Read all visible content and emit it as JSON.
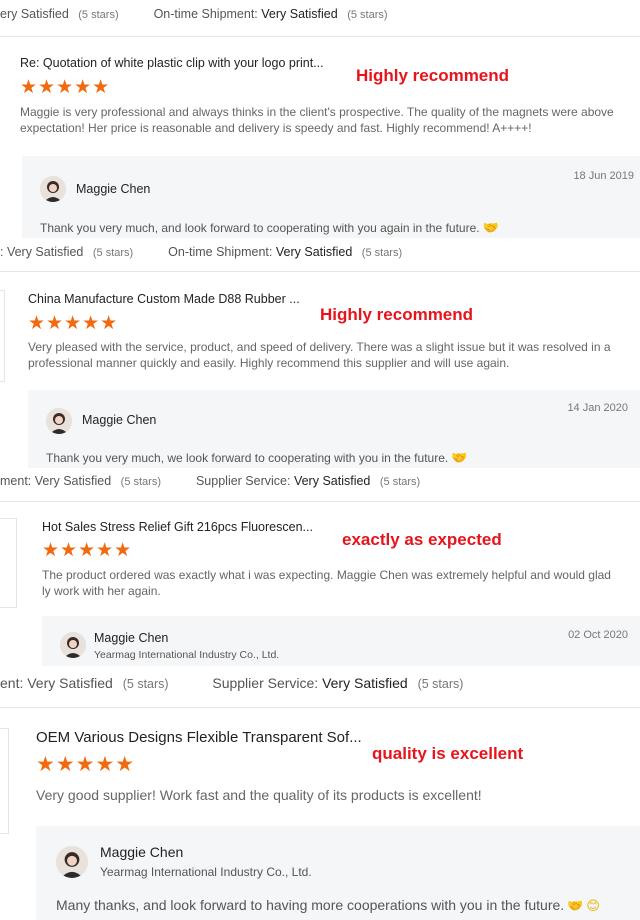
{
  "ratings": [
    {
      "k1": "ery Satisfied",
      "s1": "(5 stars)",
      "k2": "On-time Shipment:",
      "v2": "Very Satisfied",
      "s2": "(5 stars)"
    },
    {
      "k1": ": Very Satisfied",
      "s1": "(5 stars)",
      "k2": "On-time Shipment:",
      "v2": "Very Satisfied",
      "s2": "(5 stars)"
    },
    {
      "k1": "ment: Very Satisfied",
      "s1": "(5 stars)",
      "k2": "Supplier Service:",
      "v2": "Very Satisfied",
      "s2": "(5 stars)"
    },
    {
      "k1": "ent: Very Satisfied",
      "s1": "(5 stars)",
      "k2": "Supplier Service:",
      "v2": "Very Satisfied",
      "s2": "(5 stars)"
    }
  ],
  "reviews": [
    {
      "title": "Re: Quotation of white plastic clip with your logo print...",
      "stars": "★★★★★",
      "tag": "Highly recommend",
      "body": "Maggie is very professional and always thinks in the client's prospective.  The quality of the magnets were above expectation! Her price is reasonable and delivery is speedy and fast.  Highly recommend!  A++++!",
      "reply_name": "Maggie Chen",
      "reply_company": "",
      "reply_date": "18 Jun 2019",
      "reply_text": "Thank you very much, and look forward to cooperating with you again in the future."
    },
    {
      "title": "China Manufacture Custom Made D88 Rubber ...",
      "stars": "★★★★★",
      "tag": "Highly recommend",
      "body": "Very pleased with the service, product, and speed of delivery. There was a slight issue but it was resolved in a professional manner quickly and easily. Highly recommend this supplier and will use again.",
      "reply_name": "Maggie Chen",
      "reply_company": "",
      "reply_date": "14 Jan 2020",
      "reply_text": "Thank you very much, we look forward to cooperating with you in the future."
    },
    {
      "title": "Hot Sales Stress Relief Gift 216pcs Fluorescen...",
      "stars": "★★★★★",
      "tag": "exactly as expected",
      "body": "The product ordered was exactly what i was expecting. Maggie Chen was extremely helpful and would glad ly work with her again.",
      "reply_name": "Maggie Chen",
      "reply_company": "Yearmag International Industry Co., Ltd.",
      "reply_date": "02 Oct 2020",
      "reply_text": ""
    },
    {
      "title": "OEM Various Designs Flexible Transparent Sof...",
      "stars": "★★★★★",
      "tag": "quality is excellent",
      "body": "Very good supplier! Work fast and the quality of its products is excellent!",
      "reply_name": "Maggie Chen",
      "reply_company": "Yearmag International Industry Co., Ltd.",
      "reply_date": "",
      "reply_text": "Many thanks, and look forward to having more cooperations with you in the future."
    }
  ],
  "colors": {
    "stars": "#f26a10",
    "tag": "#e8141c",
    "reply_bg": "#f5f6f7"
  },
  "icons": [
    "star-icon",
    "avatar",
    "handshake-icon",
    "smile-icon"
  ]
}
